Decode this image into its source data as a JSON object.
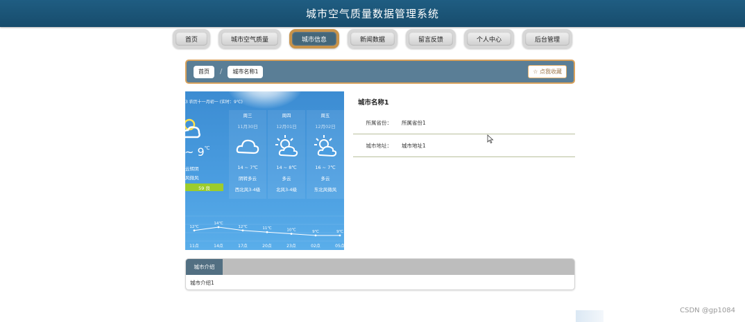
{
  "app": {
    "title": "城市空气质量数据管理系统"
  },
  "nav": [
    {
      "label": "首页"
    },
    {
      "label": "城市空气质量"
    },
    {
      "label": "城市信息",
      "active": true
    },
    {
      "label": "新闻数据"
    },
    {
      "label": "留言反馈"
    },
    {
      "label": "个人中心"
    },
    {
      "label": "后台管理"
    }
  ],
  "breadcrumb": {
    "home": "首页",
    "current": "城市名称1",
    "favorite": "☆ 点我收藏"
  },
  "weather": {
    "header": "3 农历十一月初一 (实时：9℃)",
    "today": {
      "temp": "~ 9",
      "unit": "℃",
      "cond": "云转阴",
      "wind": "风微风",
      "aqi": "59 良"
    },
    "days": [
      {
        "name": "周三",
        "date": "11月30日",
        "icon": "cloud-icon",
        "temp": "14 ~ 7℃",
        "cond": "阴转多云",
        "wind": "西北风3-4级"
      },
      {
        "name": "周四",
        "date": "12月01日",
        "icon": "sun-cloud-icon",
        "temp": "14 ~ 8℃",
        "cond": "多云",
        "wind": "北风3-4级"
      },
      {
        "name": "周五",
        "date": "12月02日",
        "icon": "sun-cloud-icon",
        "temp": "16 ~ 7℃",
        "cond": "多云",
        "wind": "东北风微风"
      }
    ],
    "hourly": {
      "temps": [
        "12℃",
        "14℃",
        "12℃",
        "11℃",
        "10℃",
        "9℃",
        "9℃"
      ],
      "values": [
        12,
        14,
        12,
        11,
        10,
        9,
        9
      ],
      "times": [
        "11点",
        "14点",
        "17点",
        "20点",
        "23点",
        "02点",
        "05点"
      ]
    }
  },
  "info": {
    "title": "城市名称1",
    "rows": [
      {
        "label": "所属省份：",
        "value": "所属省份1"
      },
      {
        "label": "城市地址：",
        "value": "城市地址1"
      }
    ]
  },
  "intro": {
    "tab": "城市介绍",
    "text": "城市介绍1"
  },
  "watermark": "CSDN @gp1084",
  "colors": {
    "topbar": "#1f5d82",
    "active_nav": "#44677a",
    "crumb_bar": "#5a7e96",
    "accent_border": "#d9a15a"
  }
}
